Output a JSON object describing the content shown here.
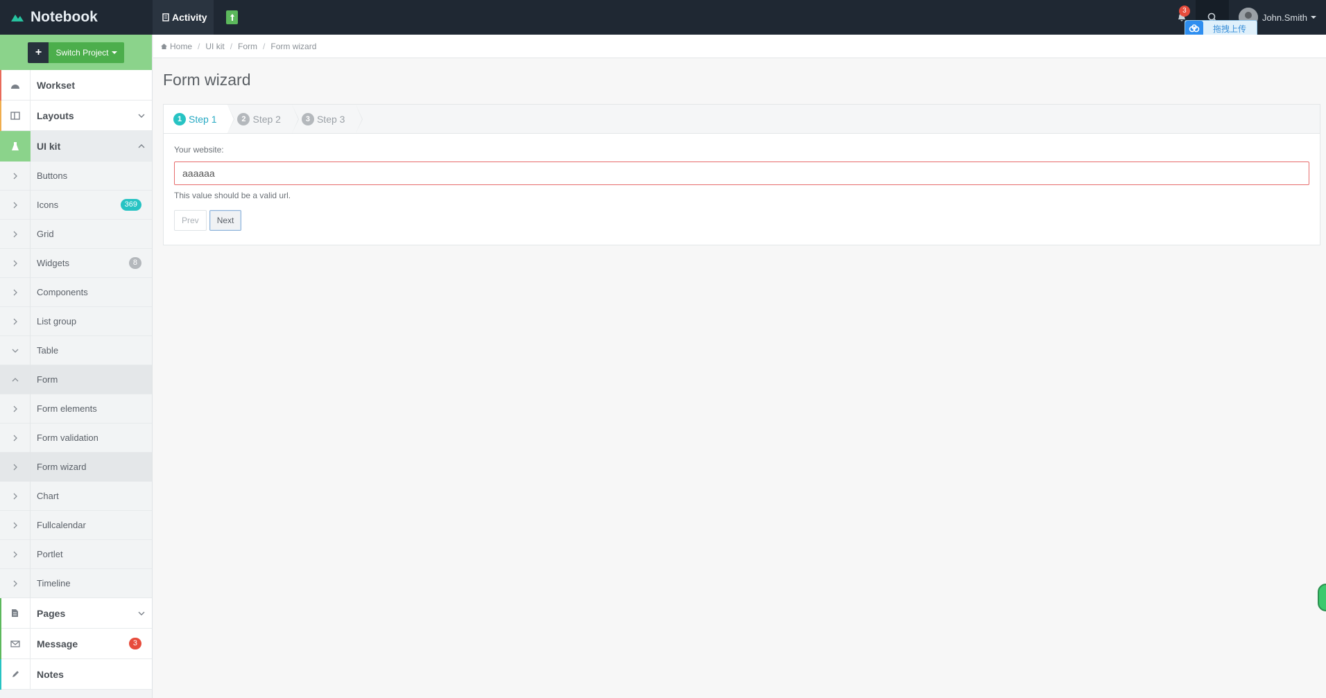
{
  "header": {
    "brand": "Notebook",
    "activity_label": "Activity",
    "notification_count": "3",
    "user_name": "John.Smith"
  },
  "upload_float": {
    "label": "拖拽上传"
  },
  "sidebar": {
    "switch_label": "Switch Project",
    "main_items": {
      "workset": "Workset",
      "layouts": "Layouts",
      "uikit": "UI kit",
      "pages": "Pages",
      "message": "Message",
      "message_badge": "3",
      "notes": "Notes"
    },
    "sub_items": [
      {
        "label": "Buttons"
      },
      {
        "label": "Icons",
        "badge": "369"
      },
      {
        "label": "Grid"
      },
      {
        "label": "Widgets",
        "badge": "8"
      },
      {
        "label": "Components"
      },
      {
        "label": "List group"
      },
      {
        "label": "Table"
      },
      {
        "label": "Form"
      },
      {
        "label": "Form elements"
      },
      {
        "label": "Form validation"
      },
      {
        "label": "Form wizard"
      },
      {
        "label": "Chart"
      },
      {
        "label": "Fullcalendar"
      },
      {
        "label": "Portlet"
      },
      {
        "label": "Timeline"
      }
    ]
  },
  "breadcrumb": [
    "Home",
    "UI kit",
    "Form",
    "Form wizard"
  ],
  "page_title": "Form wizard",
  "wizard": {
    "steps": [
      {
        "num": "1",
        "label": "Step 1"
      },
      {
        "num": "2",
        "label": "Step 2"
      },
      {
        "num": "3",
        "label": "Step 3"
      }
    ],
    "field_label": "Your website:",
    "field_value": "aaaaaa",
    "error": "This value should be a valid url.",
    "prev_label": "Prev",
    "next_label": "Next"
  },
  "colors": {
    "topbar": "#1f2833",
    "sidebar_accent": "#8bd38b",
    "step_active": "#27c3c3",
    "error_border": "#e66a6a"
  }
}
